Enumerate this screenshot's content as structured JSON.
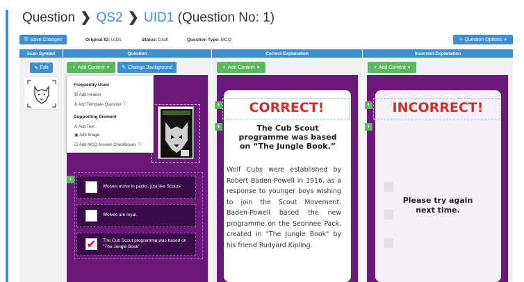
{
  "breadcrumb": {
    "question": "Question",
    "qs": "QS2",
    "uid": "UID1",
    "no": "(Question No: 1)"
  },
  "toolbar": {
    "save": "Save Changes",
    "original_label": "Original ID:",
    "original": "UID1",
    "status_label": "Status:",
    "status": "Draft",
    "type_label": "Question Type:",
    "type": "MCQ",
    "options": "Question Options"
  },
  "columns": {
    "scan": "Scan Symbol",
    "question": "Question",
    "correct": "Correct Explanation",
    "incorrect": "Incorrect Explanation"
  },
  "scan": {
    "edit": "Edit"
  },
  "question": {
    "add_content": "Add Content",
    "change_bg": "Change Background"
  },
  "dropdown": {
    "frequent": "Frequently Used",
    "add_header": "Add Header",
    "add_template": "Add Template Question",
    "supporting": "Supporting Element",
    "add_text": "Add Text",
    "add_image": "Add Image",
    "add_checkboxes": "Add MCQ Answer Checkboxes"
  },
  "options": [
    {
      "text": "Wolves move in packs, just like Scouts.",
      "checked": false
    },
    {
      "text": "Wolves are loyal.",
      "checked": false
    },
    {
      "text": "The Cub Scout programme was based on \"The Jungle Book\".",
      "checked": true
    }
  ],
  "correct": {
    "add_content": "Add Content",
    "title": "CORRECT!",
    "subtitle": "The Cub Scout programme was based on “The Jungle Book.”",
    "body": "Wolf Cubs were established by Robert Baden-Powell in 1916, as a response to younger boys wishing to join the Scout Movement. Baden-Powell based the new programme on the Seonnee Pack, created in \"The Jungle Book\" by his friend Rudyard Kipling."
  },
  "incorrect": {
    "add_content": "Add Content",
    "title": "INCORRECT!",
    "message": "Please try again next time."
  },
  "colors": {
    "blue": "#3d8fd0",
    "green": "#5cb85c",
    "purple": "#6b1a7a",
    "red": "#c9322e"
  }
}
